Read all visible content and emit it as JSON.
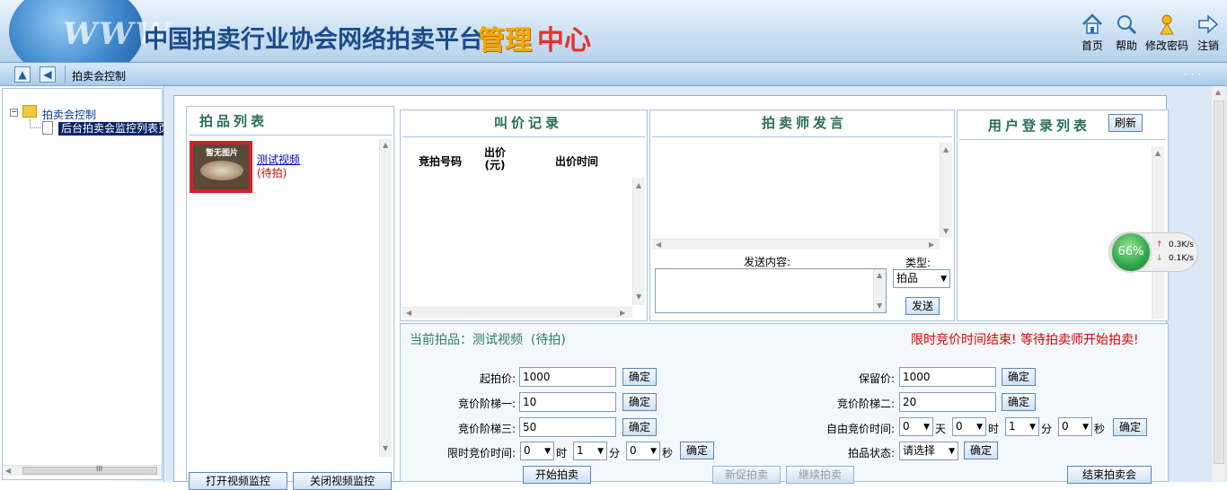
{
  "header": {
    "title_main": "中国拍卖行业协会网络拍卖平台",
    "title_accent_1": "管理",
    "title_accent_2": "中心",
    "watermark": "WWW",
    "toolbar": [
      {
        "label": "首页",
        "icon": "home-icon"
      },
      {
        "label": "帮助",
        "icon": "help-icon"
      },
      {
        "label": "修改密码",
        "icon": "key-icon"
      },
      {
        "label": "注销",
        "icon": "logout-icon"
      }
    ]
  },
  "navbar": {
    "tab": "拍卖会控制",
    "dots": "· · ·"
  },
  "tree": {
    "root": "拍卖会控制",
    "child": "后台拍卖会监控列表页"
  },
  "lots_panel": {
    "title": "拍品列表",
    "thumb_text": "暂无图片",
    "item_name": "测试视频",
    "item_status": "(待拍)",
    "bottom_buttons": [
      "打开视频监控",
      "关闭视频监控"
    ]
  },
  "bid_panel": {
    "title": "叫价记录",
    "columns": [
      "竞拍号码",
      "出价\n(元)",
      "出价时间"
    ]
  },
  "auctioneer_panel": {
    "title": "拍卖师发言",
    "send_label": "发送内容:",
    "type_label": "类型:",
    "type_value": "拍品",
    "send_button": "发送"
  },
  "users_panel": {
    "title": "用户登录列表",
    "refresh_button": "刷新"
  },
  "widget": {
    "percent": "66%",
    "up": "0.3K/s",
    "down": "0.1K/s"
  },
  "control": {
    "current_lot": "当前拍品：测试视频  (待拍)",
    "alert": "限时竞价时间结束! 等待拍卖师开始拍卖!",
    "confirm": "确定",
    "start_price": {
      "label": "起拍价:",
      "value": "1000"
    },
    "reserve_price": {
      "label": "保留价:",
      "value": "1000"
    },
    "step1": {
      "label": "竞价阶梯一:",
      "value": "10"
    },
    "step2": {
      "label": "竞价阶梯二:",
      "value": "20"
    },
    "step3": {
      "label": "竞价阶梯三:",
      "value": "50"
    },
    "free_time": {
      "label": "自由竞价时间:",
      "days": "0",
      "hours": "0",
      "minutes": "1",
      "seconds": "0"
    },
    "limit_time": {
      "label": "限时竞价时间:",
      "hours": "0",
      "minutes": "1",
      "seconds": "0"
    },
    "unit_day": "天",
    "unit_hour": "时",
    "unit_min": "分",
    "unit_sec": "秒",
    "lot_status": {
      "label": "拍品状态:",
      "value": "请选择"
    },
    "buttons": {
      "start": "开始拍卖",
      "new": "新促拍卖",
      "continue": "继续拍卖",
      "end": "结束拍卖会"
    }
  }
}
